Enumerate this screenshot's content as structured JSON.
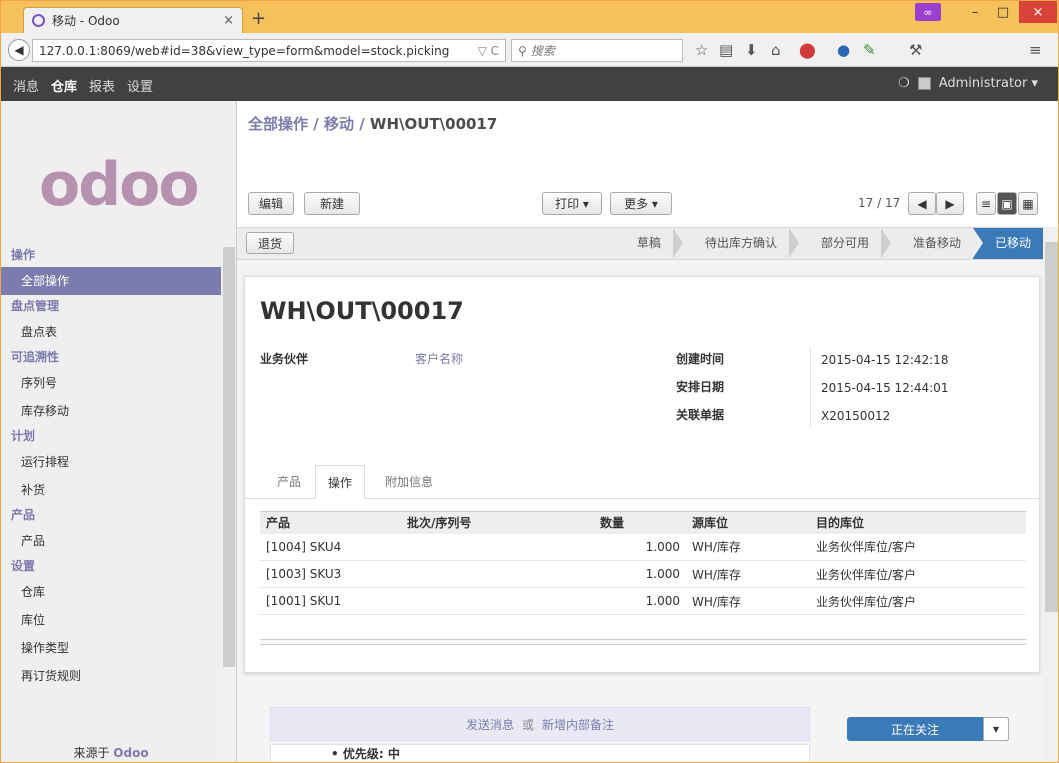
{
  "browser": {
    "tab_title": "移动 - Odoo",
    "tab_close": "×",
    "new_tab": "+",
    "url": "127.0.0.1:8069/web#id=38&view_type=form&model=stock.picking",
    "search_placeholder": "搜索",
    "min": "–",
    "max": "□",
    "close": "×"
  },
  "topmenu": {
    "items": [
      "消息",
      "仓库",
      "报表",
      "设置"
    ],
    "active": "仓库",
    "user": "Administrator ▾"
  },
  "sidebar": {
    "logo": "odoo",
    "sections": [
      {
        "header": "操作",
        "items": [
          "全部操作"
        ]
      },
      {
        "header": "盘点管理",
        "items": [
          "盘点表"
        ]
      },
      {
        "header": "可追溯性",
        "items": [
          "序列号",
          "库存移动"
        ]
      },
      {
        "header": "计划",
        "items": [
          "运行排程",
          "补货"
        ]
      },
      {
        "header": "产品",
        "items": [
          "产品"
        ]
      },
      {
        "header": "设置",
        "items": [
          "仓库",
          "库位",
          "操作类型",
          "再订货规则"
        ]
      }
    ],
    "active_item": "全部操作",
    "footer_prefix": "来源于",
    "footer_brand": "Odoo"
  },
  "breadcrumb": {
    "part1": "全部操作",
    "sep": " / ",
    "part2": "移动",
    "current": "WH\\OUT\\00017"
  },
  "toolbar": {
    "edit": "编辑",
    "create": "新建",
    "print": "打印 ▾",
    "more": "更多 ▾",
    "pager": "17 / 17"
  },
  "status": {
    "return_button": "退货",
    "stages": [
      "草稿",
      "待出库方确认",
      "部分可用",
      "准备移动",
      "已移动"
    ],
    "current_stage": "已移动"
  },
  "form": {
    "title": "WH\\OUT\\00017",
    "partner_label": "业务伙伴",
    "partner_value": "客户名称",
    "created_label": "创建时间",
    "created_value": "2015-04-15 12:42:18",
    "scheduled_label": "安排日期",
    "scheduled_value": "2015-04-15 12:44:01",
    "origin_label": "关联单据",
    "origin_value": "X20150012",
    "tabs": [
      "产品",
      "操作",
      "附加信息"
    ],
    "active_tab": "操作"
  },
  "table": {
    "headers": [
      "产品",
      "批次/序列号",
      "数量",
      "源库位",
      "目的库位"
    ],
    "rows": [
      [
        "[1004] SKU4",
        "",
        "1.000",
        "WH/库存",
        "业务伙伴库位/客户"
      ],
      [
        "[1003] SKU3",
        "",
        "1.000",
        "WH/库存",
        "业务伙伴库位/客户"
      ],
      [
        "[1001] SKU1",
        "",
        "1.000",
        "WH/库存",
        "业务伙伴库位/客户"
      ]
    ]
  },
  "chatter": {
    "send": "发送消息",
    "or": "或",
    "note": "新增内部备注",
    "follow": "正在关注",
    "priority": "• 优先级: 中"
  }
}
